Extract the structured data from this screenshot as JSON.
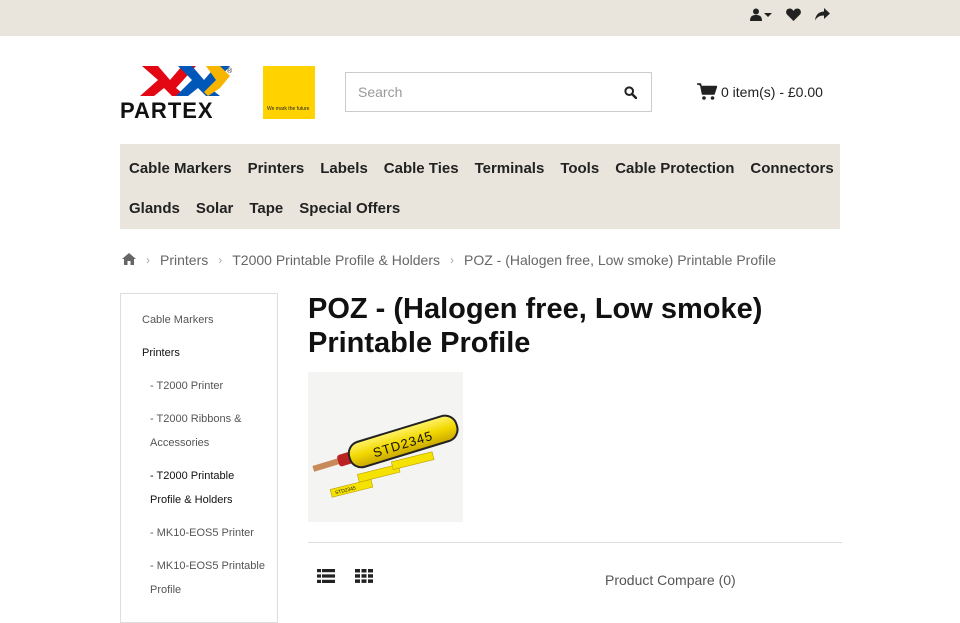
{
  "colors": {
    "topbar": "#e9e5dc",
    "menu_bg": "#e9e5dc",
    "logo_yellow": "#ffd200",
    "logo_red": "#e30613",
    "logo_blue": "#0057b8"
  },
  "topbar": {
    "icons": [
      "user-icon",
      "heart-icon",
      "share-icon"
    ]
  },
  "logo": {
    "brand": "PARTEX",
    "reg": "®",
    "tagline": "We mark the future"
  },
  "search": {
    "placeholder": "Search",
    "value": ""
  },
  "cart": {
    "label": "0 item(s) - £0.00"
  },
  "menu": {
    "row1": [
      "Cable Markers",
      "Printers",
      "Labels",
      "Cable Ties",
      "Terminals",
      "Tools",
      "Cable Protection",
      "Connectors"
    ],
    "row2": [
      "Glands",
      "Solar",
      "Tape",
      "Special Offers"
    ]
  },
  "breadcrumb": [
    "Printers",
    "T2000 Printable Profile & Holders",
    "POZ - (Halogen free, Low smoke) Printable Profile"
  ],
  "sidebar": [
    {
      "label": "Cable Markers"
    },
    {
      "label": "Printers"
    },
    {
      "label": "- T2000 Printer"
    },
    {
      "label": "- T2000 Ribbons & Accessories"
    },
    {
      "label": "- T2000 Printable Profile & Holders"
    },
    {
      "label": "- MK10-EOS5 Printer"
    },
    {
      "label": "- MK10-EOS5 Printable Profile"
    }
  ],
  "product": {
    "title": "POZ - (Halogen free, Low smoke) Printable Profile",
    "image_text": "STD2345",
    "image_text_small": "STD2345"
  },
  "toolbar": {
    "compare_label": "Product Compare (0)"
  }
}
